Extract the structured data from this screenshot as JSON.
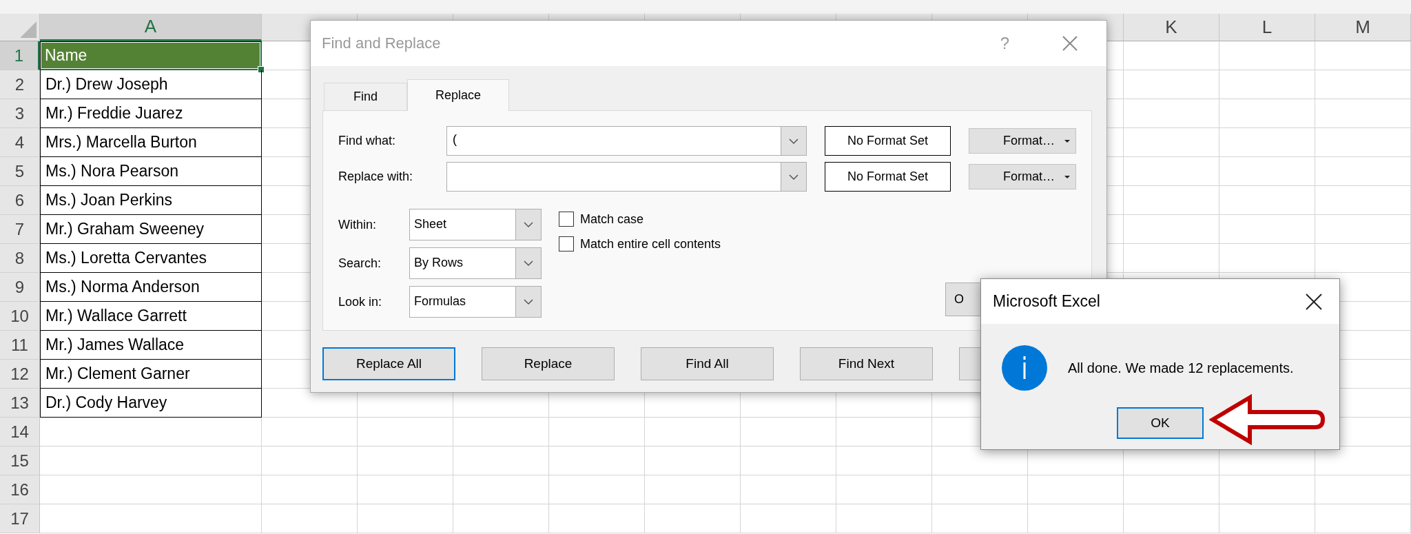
{
  "sheet": {
    "columns": [
      {
        "label": "A",
        "selected": true
      },
      {
        "selected": false
      },
      {
        "selected": false
      },
      {
        "selected": false
      },
      {
        "selected": false
      },
      {
        "selected": false
      },
      {
        "selected": false
      },
      {
        "selected": false
      },
      {
        "selected": false
      },
      {
        "selected": false
      },
      {
        "label": "K",
        "selected": false
      },
      {
        "label": "L",
        "selected": false
      },
      {
        "label": "M",
        "selected": false
      }
    ],
    "rows": [
      {
        "number": "1",
        "selected": true,
        "cells": [
          {
            "text": "Name",
            "selected": true
          }
        ]
      },
      {
        "number": "2",
        "selected": false,
        "cells": [
          {
            "text": "Dr.) Drew Joseph",
            "selected": false
          }
        ]
      },
      {
        "number": "3",
        "selected": false,
        "cells": [
          {
            "text": "Mr.) Freddie Juarez",
            "selected": false
          }
        ]
      },
      {
        "number": "4",
        "selected": false,
        "cells": [
          {
            "text": "Mrs.) Marcella Burton",
            "selected": false
          }
        ]
      },
      {
        "number": "5",
        "selected": false,
        "cells": [
          {
            "text": "Ms.) Nora Pearson",
            "selected": false
          }
        ]
      },
      {
        "number": "6",
        "selected": false,
        "cells": [
          {
            "text": "Ms.) Joan Perkins",
            "selected": false
          }
        ]
      },
      {
        "number": "7",
        "selected": false,
        "cells": [
          {
            "text": "Mr.) Graham Sweeney",
            "selected": false
          }
        ]
      },
      {
        "number": "8",
        "selected": false,
        "cells": [
          {
            "text": "Ms.) Loretta Cervantes",
            "selected": false
          }
        ]
      },
      {
        "number": "9",
        "selected": false,
        "cells": [
          {
            "text": "Ms.) Norma Anderson",
            "selected": false
          }
        ]
      },
      {
        "number": "10",
        "selected": false,
        "cells": [
          {
            "text": "Mr.) Wallace Garrett",
            "selected": false
          }
        ]
      },
      {
        "number": "11",
        "selected": false,
        "cells": [
          {
            "text": "Mr.) James Wallace",
            "selected": false
          }
        ]
      },
      {
        "number": "12",
        "selected": false,
        "cells": [
          {
            "text": "Mr.) Clement Garner",
            "selected": false
          }
        ]
      },
      {
        "number": "13",
        "selected": false,
        "cells": [
          {
            "text": "Dr.) Cody Harvey",
            "selected": false
          }
        ]
      },
      {
        "number": "14",
        "selected": false
      },
      {
        "number": "15",
        "selected": false
      },
      {
        "number": "16",
        "selected": false
      },
      {
        "number": "17",
        "selected": false
      }
    ]
  },
  "find_replace_dialog": {
    "title": "Find and Replace",
    "help_button": "?",
    "tabs": [
      {
        "label": "Find",
        "selected": false
      },
      {
        "label": "Replace",
        "selected": true
      }
    ],
    "fields": [
      {
        "label": "Find what:",
        "value": "(",
        "format": "No Format Set",
        "format_button": "Format…"
      },
      {
        "label": "Replace with:",
        "format": "No Format Set",
        "format_button": "Format…"
      }
    ],
    "dropdowns": [
      {
        "label": "Within:",
        "value": "Sheet"
      },
      {
        "label": "Search:",
        "value": "By Rows"
      },
      {
        "label": "Look in:",
        "value": "Formulas"
      }
    ],
    "checkboxes": [
      {
        "label": "Match case",
        "checked": false
      },
      {
        "label": "Match entire cell contents",
        "checked": false
      }
    ],
    "options_button": "O",
    "buttons": [
      {
        "label": "Replace All",
        "default": true
      },
      {
        "label": "Replace",
        "default": false
      },
      {
        "label": "Find All",
        "default": false
      },
      {
        "label": "Find Next",
        "default": false
      },
      {
        "default": false
      }
    ]
  },
  "message_box": {
    "title": "Microsoft Excel",
    "message": "All done. We made 12 replacements.",
    "button": {
      "label": "OK",
      "default": true
    }
  },
  "annotations": [
    {
      "kind": "arrow"
    }
  ]
}
